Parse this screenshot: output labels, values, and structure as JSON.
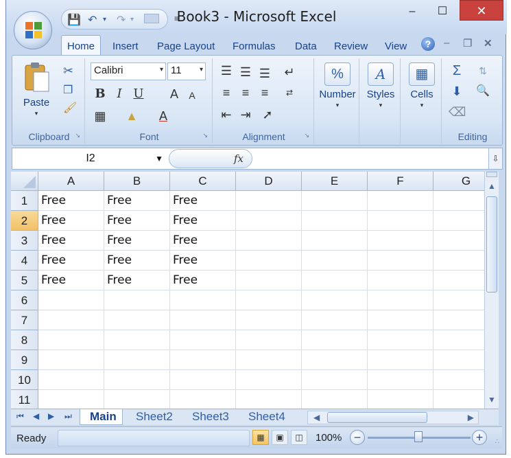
{
  "window": {
    "title": "Book3 - Microsoft Excel",
    "controls": {
      "minimize": "–",
      "maximize": "☐",
      "close": "✕"
    }
  },
  "ribbon_tabs": [
    "Home",
    "Insert",
    "Page Layout",
    "Formulas",
    "Data",
    "Review",
    "View"
  ],
  "active_tab": "Home",
  "help_label": "?",
  "ribbon": {
    "clipboard": {
      "paste_label": "Paste",
      "group_label": "Clipboard"
    },
    "font": {
      "font_name": "Calibri",
      "font_size": "11",
      "bold": "B",
      "italic": "I",
      "underline": "U",
      "grow": "A",
      "shrink": "A",
      "font_color": "A",
      "group_label": "Font"
    },
    "alignment": {
      "group_label": "Alignment"
    },
    "number": {
      "label": "Number",
      "icon_text": "%"
    },
    "styles": {
      "label": "Styles",
      "icon_text": "A"
    },
    "cells": {
      "label": "Cells"
    },
    "editing": {
      "group_label": "Editing"
    }
  },
  "formula_bar": {
    "name_box": "I2",
    "fx_label": "fx",
    "formula": ""
  },
  "grid": {
    "columns": [
      "A",
      "B",
      "C",
      "D",
      "E",
      "F",
      "G"
    ],
    "rows": [
      "1",
      "2",
      "3",
      "4",
      "5",
      "6",
      "7",
      "8",
      "9",
      "10",
      "11"
    ],
    "active_row": "2",
    "cells": [
      [
        "Free",
        "Free",
        "Free",
        "",
        "",
        "",
        ""
      ],
      [
        "Free",
        "Free",
        "Free",
        "",
        "",
        "",
        ""
      ],
      [
        "Free",
        "Free",
        "Free",
        "",
        "",
        "",
        ""
      ],
      [
        "Free",
        "Free",
        "Free",
        "",
        "",
        "",
        ""
      ],
      [
        "Free",
        "Free",
        "Free",
        "",
        "",
        "",
        ""
      ],
      [
        "",
        "",
        "",
        "",
        "",
        "",
        ""
      ],
      [
        "",
        "",
        "",
        "",
        "",
        "",
        ""
      ],
      [
        "",
        "",
        "",
        "",
        "",
        "",
        ""
      ],
      [
        "",
        "",
        "",
        "",
        "",
        "",
        ""
      ],
      [
        "",
        "",
        "",
        "",
        "",
        "",
        ""
      ],
      [
        "",
        "",
        "",
        "",
        "",
        "",
        ""
      ]
    ]
  },
  "sheets": [
    "Main",
    "Sheet2",
    "Sheet3",
    "Sheet4"
  ],
  "active_sheet": "Main",
  "status": {
    "text": "Ready",
    "zoom": "100%"
  },
  "colors": {
    "accent": "#15428b",
    "active_row_header": "#f4c56a",
    "close_button": "#c9413c"
  }
}
